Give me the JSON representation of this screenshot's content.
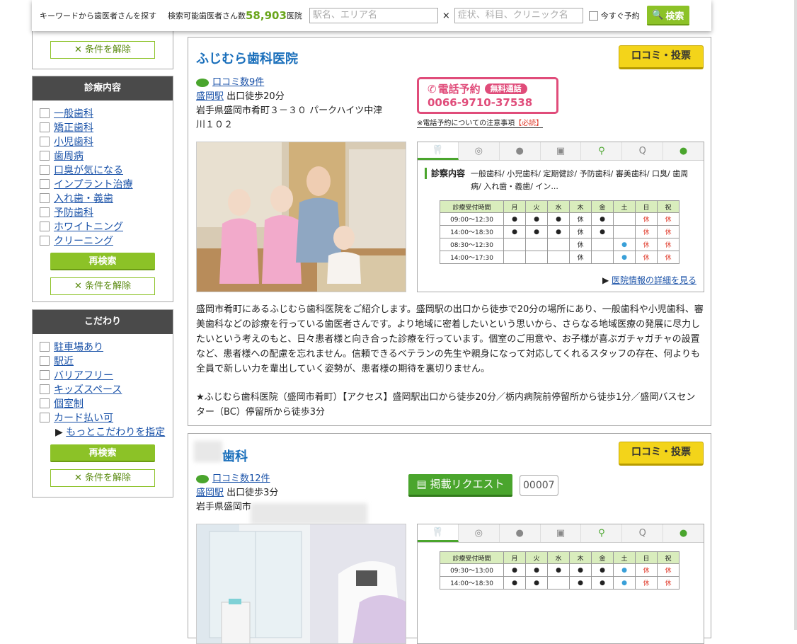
{
  "topbar": {
    "label": "キーワードから歯医者さんを探す",
    "count_label": "検索可能歯医者さん数",
    "count_value": "58,903",
    "count_unit": "医院",
    "input1_placeholder": "駅名、エリア名",
    "cross": "×",
    "input2_placeholder": "症状、科目、クリニック名",
    "now_label": "今すぐ予約",
    "search_label": "検索"
  },
  "sidebar": {
    "clear_label": "条件を解除",
    "treatment": {
      "header": "診療内容",
      "items": [
        "一般歯科",
        "矯正歯科",
        "小児歯科",
        "歯周病",
        "口臭が気になる",
        "インプラント治療",
        "入れ歯・義歯",
        "予防歯科",
        "ホワイトニング",
        "クリーニング"
      ],
      "research_label": "再検索",
      "clear_label": "条件を解除"
    },
    "kodawari": {
      "header": "こだわり",
      "items": [
        "駐車場あり",
        "駅近",
        "バリアフリー",
        "キッズスペース",
        "個室制",
        "カード払い可"
      ],
      "more_label": "もっとこだわりを指定",
      "research_label": "再検索",
      "clear_label": "条件を解除"
    }
  },
  "clinic1": {
    "name": "ふじむら歯科医院",
    "review_btn": "口コミ・投票",
    "reviews": "口コミ数9件",
    "station": "盛岡駅",
    "access": "出口徒歩20分",
    "address1": "岩手県盛岡市肴町３－３０ パークハイツ中津",
    "address2": "川１０２",
    "tel_label": "電話予約",
    "tel_badge": "無料通話",
    "tel_number": "0066-9710-37538",
    "tel_note": "※電話予約についての注意事項",
    "tel_note_must": "【必読】",
    "treat_label": "診察内容",
    "treat_text": "一般歯科/ 小児歯科/ 定期健診/ 予防歯科/ 審美歯科/ 口臭/ 歯周病/ 入れ歯・義歯/ イン...",
    "schedule_header": [
      "診療受付時間",
      "月",
      "火",
      "水",
      "木",
      "金",
      "土",
      "日",
      "祝"
    ],
    "schedule": [
      [
        "09:00～12:30",
        "●",
        "●",
        "●",
        "休",
        "●",
        "",
        "休",
        "休"
      ],
      [
        "14:00～18:30",
        "●",
        "●",
        "●",
        "休",
        "●",
        "",
        "休",
        "休"
      ],
      [
        "08:30～12:30",
        "",
        "",
        "",
        "休",
        "",
        "●",
        "休",
        "休"
      ],
      [
        "14:00～17:30",
        "",
        "",
        "",
        "休",
        "",
        "●",
        "休",
        "休"
      ]
    ],
    "detail_link": "医院情報の詳細を見る",
    "desc": "盛岡市肴町にあるふじむら歯科医院をご紹介します。盛岡駅の出口から徒歩で20分の場所にあり、一般歯科や小児歯科、審美歯科などの診療を行っている歯医者さんです。より地域に密着したいという思いから、さらなる地域医療の発展に尽力したいという考えのもと、日々患者様と向き合った診療を行っています。個室のご用意や、お子様が喜ぶガチャガチャの設置など、患者様への配慮を忘れません。信頼できるベテランの先生や親身になって対応してくれるスタッフの存在、何よりも全員で新しい力を輩出していく姿勢が、患者様の期待を裏切りません。",
    "access_text": "★ふじむら歯科医院（盛岡市肴町）【アクセス】盛岡駅出口から徒歩20分／栃内病院前停留所から徒歩1分／盛岡バスセンター（BC）停留所から徒歩3分"
  },
  "clinic2": {
    "name": "歯科",
    "review_btn": "口コミ・投票",
    "reviews": "口コミ数12件",
    "station": "盛岡駅",
    "access": "出口徒歩3分",
    "address": "岩手県盛岡市",
    "request_label": "掲載リクエスト",
    "request_count": "00007",
    "schedule_header": [
      "診療受付時間",
      "月",
      "火",
      "水",
      "木",
      "金",
      "土",
      "日",
      "祝"
    ],
    "schedule": [
      [
        "09:30～13:00",
        "●",
        "●",
        "●",
        "●",
        "●",
        "●",
        "休",
        "休"
      ],
      [
        "14:00～18:30",
        "●",
        "●",
        "",
        "●",
        "●",
        "●",
        "休",
        "休"
      ]
    ]
  },
  "colors": {
    "green": "#8cc227",
    "accent_blue": "#1a6fbb",
    "tel_pink": "#e04c7a",
    "yellow": "#f3d41a"
  }
}
